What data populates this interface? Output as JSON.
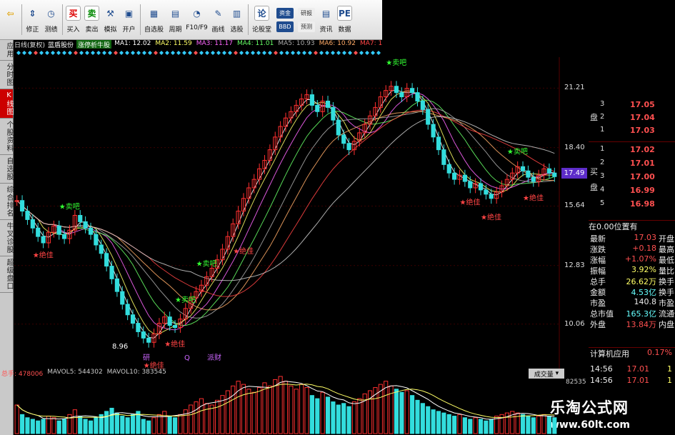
{
  "toolbar": {
    "buttons": [
      {
        "label": "",
        "icon": "back-arrow"
      },
      {
        "label": "修正",
        "icon": "up-down-arrows"
      },
      {
        "label": "测绩",
        "icon": "clock"
      },
      {
        "label": "买入",
        "icon_text": "买"
      },
      {
        "label": "卖出",
        "icon_text": "卖"
      },
      {
        "label": "模拟",
        "icon": "hammer"
      },
      {
        "label": "开户",
        "icon": "lock"
      },
      {
        "label": "自选股",
        "icon": "grid"
      },
      {
        "label": "周期",
        "icon": "calendar"
      },
      {
        "label": "F10/F9",
        "icon": "gauge"
      },
      {
        "label": "画线",
        "icon": "pen"
      },
      {
        "label": "选股",
        "icon": "screen"
      },
      {
        "label": "论股堂",
        "icon_text": "论"
      },
      {
        "label": "资讯",
        "icon": "news"
      },
      {
        "label": "数据",
        "icon_text": "PE"
      }
    ],
    "mini_buttons": [
      "资金",
      "BBD",
      "研报",
      "预测"
    ]
  },
  "left_tabs": [
    "应用",
    "分时图",
    "K线图",
    "个股资料",
    "自选股",
    "综合排名",
    "牛叉诊股",
    "超级盘口"
  ],
  "active_tab": "K线图",
  "ma_header": {
    "period": "日线(复权)",
    "name": "蓝盾股份",
    "formula": "涨停析牛股",
    "items": [
      {
        "label": "MA1: 12.02",
        "color": "#ffffff"
      },
      {
        "label": "MA2: 11.59",
        "color": "#ffff66"
      },
      {
        "label": "MA3: 11.17",
        "color": "#ff66ff"
      },
      {
        "label": "MA4: 11.01",
        "color": "#66ff66"
      },
      {
        "label": "MA5: 10.93",
        "color": "#aaaaaa"
      },
      {
        "label": "MA6: 10.92",
        "color": "#ffaa66"
      },
      {
        "label": "MA7: 11.44",
        "color": "#ff4444"
      },
      {
        "label": "MA8",
        "color": "#cccccc"
      }
    ]
  },
  "price_axis": [
    "21.21",
    "18.40",
    "15.64",
    "12.83",
    "10.06"
  ],
  "current_price": "17.49",
  "signals": {
    "buy": "卖吧",
    "sell": "绝佳"
  },
  "chart_annotations": [
    "8.96",
    "研",
    "Q",
    "派财"
  ],
  "volume_header": {
    "total": "总手: 478006",
    "mavol5": "MAVOL5: 544302",
    "mavol10": "MAVOL10: 383545"
  },
  "volume_combo": "成交量",
  "volume_axis": "82535",
  "orderbook": {
    "sell": [
      {
        "level": "3",
        "price": "17.05"
      },
      {
        "level": "2",
        "price": "17.04"
      },
      {
        "level": "1",
        "price": "17.03"
      }
    ],
    "buy": [
      {
        "level": "1",
        "price": "17.02"
      },
      {
        "level": "2",
        "price": "17.01"
      },
      {
        "level": "3",
        "price": "17.00"
      },
      {
        "level": "4",
        "price": "16.99"
      },
      {
        "level": "5",
        "price": "16.98"
      }
    ],
    "sell_side_label": "盘",
    "buy_side_label": "买盘"
  },
  "position_label": "在0.00位置有",
  "stats": [
    {
      "label": "最新",
      "value": "17.03",
      "right": "开盘",
      "color": "#ff5050"
    },
    {
      "label": "涨跌",
      "value": "+0.18",
      "right": "最高",
      "color": "#ff5050"
    },
    {
      "label": "涨幅",
      "value": "+1.07%",
      "right": "最低",
      "color": "#ff5050"
    },
    {
      "label": "振幅",
      "value": "3.92%",
      "right": "量比",
      "color": "#ffff66"
    },
    {
      "label": "总手",
      "value": "26.62万",
      "right": "换手",
      "color": "#ffff66"
    },
    {
      "label": "金额",
      "value": "4.53亿",
      "right": "换手E",
      "color": "#66ffff"
    },
    {
      "label": "市盈",
      "value": "140.8",
      "right": "市盈E",
      "color": "#eeeeee"
    },
    {
      "label": "总市值",
      "value": "165.3亿",
      "right": "流通值",
      "color": "#66ffff"
    },
    {
      "label": "外盘",
      "value": "13.84万",
      "right": "内盘",
      "color": "#ff5050"
    }
  ],
  "industry": {
    "name": "计算机应用",
    "change": "0.17%"
  },
  "ticks": [
    {
      "time": "14:56",
      "price": "17.01",
      "vol": "1"
    },
    {
      "time": "14:56",
      "price": "17.01",
      "vol": "1"
    }
  ],
  "watermark": {
    "title": "乐淘公式网",
    "url": "www.60lt.com"
  },
  "colors": {
    "up": "#ff3030",
    "down": "#33dddd",
    "bg": "#000000"
  },
  "chart_data": {
    "type": "candlestick",
    "ylim": [
      8.5,
      22
    ],
    "ticks": [
      21.21,
      18.4,
      15.64,
      12.83,
      10.06
    ],
    "closes": [
      15.9,
      15.4,
      15.0,
      14.6,
      14.2,
      13.9,
      14.4,
      14.7,
      14.3,
      14.1,
      14.5,
      15.2,
      14.9,
      14.6,
      14.3,
      13.8,
      13.4,
      12.8,
      12.2,
      11.6,
      11.0,
      10.5,
      10.1,
      9.7,
      9.4,
      9.2,
      9.6,
      10.1,
      10.4,
      10.0,
      9.9,
      10.3,
      10.8,
      11.3,
      11.6,
      11.9,
      12.3,
      12.7,
      13.1,
      13.6,
      14.2,
      14.8,
      15.4,
      16.0,
      16.5,
      16.9,
      17.4,
      17.8,
      18.3,
      18.9,
      19.4,
      19.8,
      20.1,
      20.4,
      20.7,
      20.9,
      20.4,
      20.1,
      20.6,
      20.3,
      19.7,
      19.0,
      18.6,
      18.3,
      18.7,
      19.1,
      19.5,
      19.9,
      20.3,
      20.8,
      21.1,
      21.3,
      21.0,
      20.8,
      21.2,
      21.0,
      20.6,
      20.2,
      19.5,
      18.9,
      18.3,
      17.6,
      17.2,
      16.9,
      17.1,
      16.8,
      16.5,
      16.7,
      16.4,
      16.2,
      16.0,
      16.3,
      16.6,
      16.9,
      17.2,
      17.5,
      17.3,
      17.0,
      16.8,
      17.1,
      17.4,
      17.2,
      17.03
    ],
    "volumes": [
      18,
      12,
      10,
      9,
      8,
      9,
      11,
      10,
      8,
      9,
      12,
      15,
      11,
      9,
      8,
      10,
      12,
      14,
      16,
      13,
      11,
      10,
      12,
      14,
      9,
      8,
      10,
      12,
      14,
      11,
      10,
      12,
      15,
      18,
      20,
      22,
      19,
      18,
      21,
      24,
      27,
      30,
      33,
      31,
      28,
      26,
      29,
      32,
      30,
      34,
      36,
      33,
      30,
      28,
      31,
      29,
      24,
      22,
      26,
      23,
      20,
      18,
      19,
      17,
      20,
      22,
      25,
      27,
      29,
      31,
      33,
      30,
      28,
      26,
      27,
      24,
      21,
      19,
      17,
      15,
      14,
      13,
      12,
      11,
      12,
      10,
      9,
      10,
      9,
      8,
      9,
      11,
      12,
      13,
      14,
      13,
      12,
      11,
      10,
      11,
      12,
      11,
      10
    ]
  }
}
